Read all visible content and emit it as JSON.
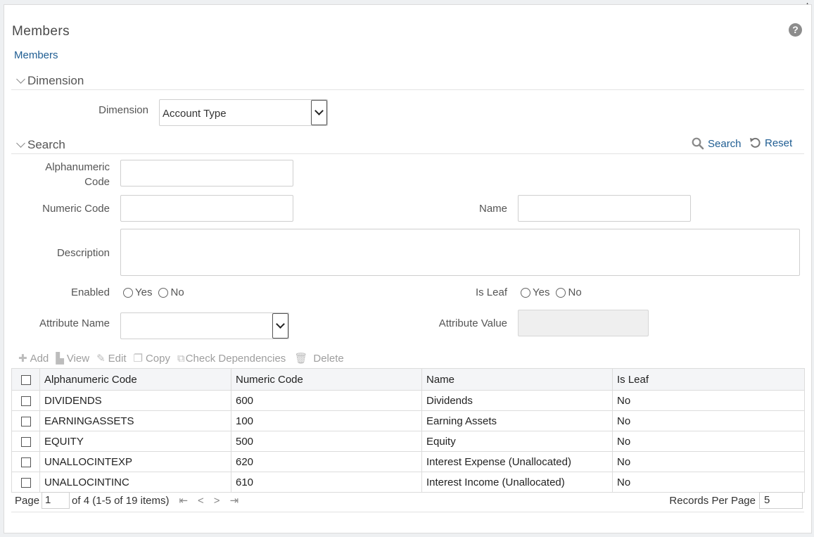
{
  "page": {
    "title": "Members",
    "breadcrumb": "Members",
    "help_icon": "?"
  },
  "dimension_section": {
    "header": "Dimension",
    "dimension_label": "Dimension",
    "dimension_value": "Account Type"
  },
  "search_section": {
    "header": "Search",
    "search_label": "Search",
    "reset_label": "Reset",
    "fields": {
      "alphanumeric_code_label_line1": "Alphanumeric",
      "alphanumeric_code_label_line2": "Code",
      "alphanumeric_code_value": "",
      "numeric_code_label": "Numeric Code",
      "numeric_code_value": "",
      "name_label": "Name",
      "name_value": "",
      "description_label": "Description",
      "description_value": "",
      "enabled_label": "Enabled",
      "is_leaf_label": "Is Leaf",
      "yes_label": "Yes",
      "no_label": "No",
      "attribute_name_label": "Attribute Name",
      "attribute_name_value": "",
      "attribute_value_label": "Attribute Value",
      "attribute_value_value": ""
    }
  },
  "toolbar": {
    "add": "Add",
    "view": "View",
    "edit": "Edit",
    "copy": "Copy",
    "check_dependencies": "Check Dependencies",
    "delete": "Delete"
  },
  "grid": {
    "columns": [
      "Alphanumeric Code",
      "Numeric Code",
      "Name",
      "Is Leaf"
    ],
    "rows": [
      [
        "DIVIDENDS",
        "600",
        "Dividends",
        "No"
      ],
      [
        "EARNINGASSETS",
        "100",
        "Earning Assets",
        "No"
      ],
      [
        "EQUITY",
        "500",
        "Equity",
        "No"
      ],
      [
        "UNALLOCINTEXP",
        "620",
        "Interest Expense (Unallocated)",
        "No"
      ],
      [
        "UNALLOCINTINC",
        "610",
        "Interest Income (Unallocated)",
        "No"
      ]
    ]
  },
  "pager": {
    "page_label": "Page",
    "page_value": "1",
    "of_text": "of 4 (1-5 of 19 items)",
    "first": "K",
    "prev": "<",
    "next": ">",
    "last": "K",
    "records_per_page_label": "Records Per Page",
    "records_per_page_value": "5"
  },
  "colors": {
    "link": "#1f5d92",
    "header_bg": "#f4f5f7",
    "disabled_text": "#9e9e9e"
  }
}
